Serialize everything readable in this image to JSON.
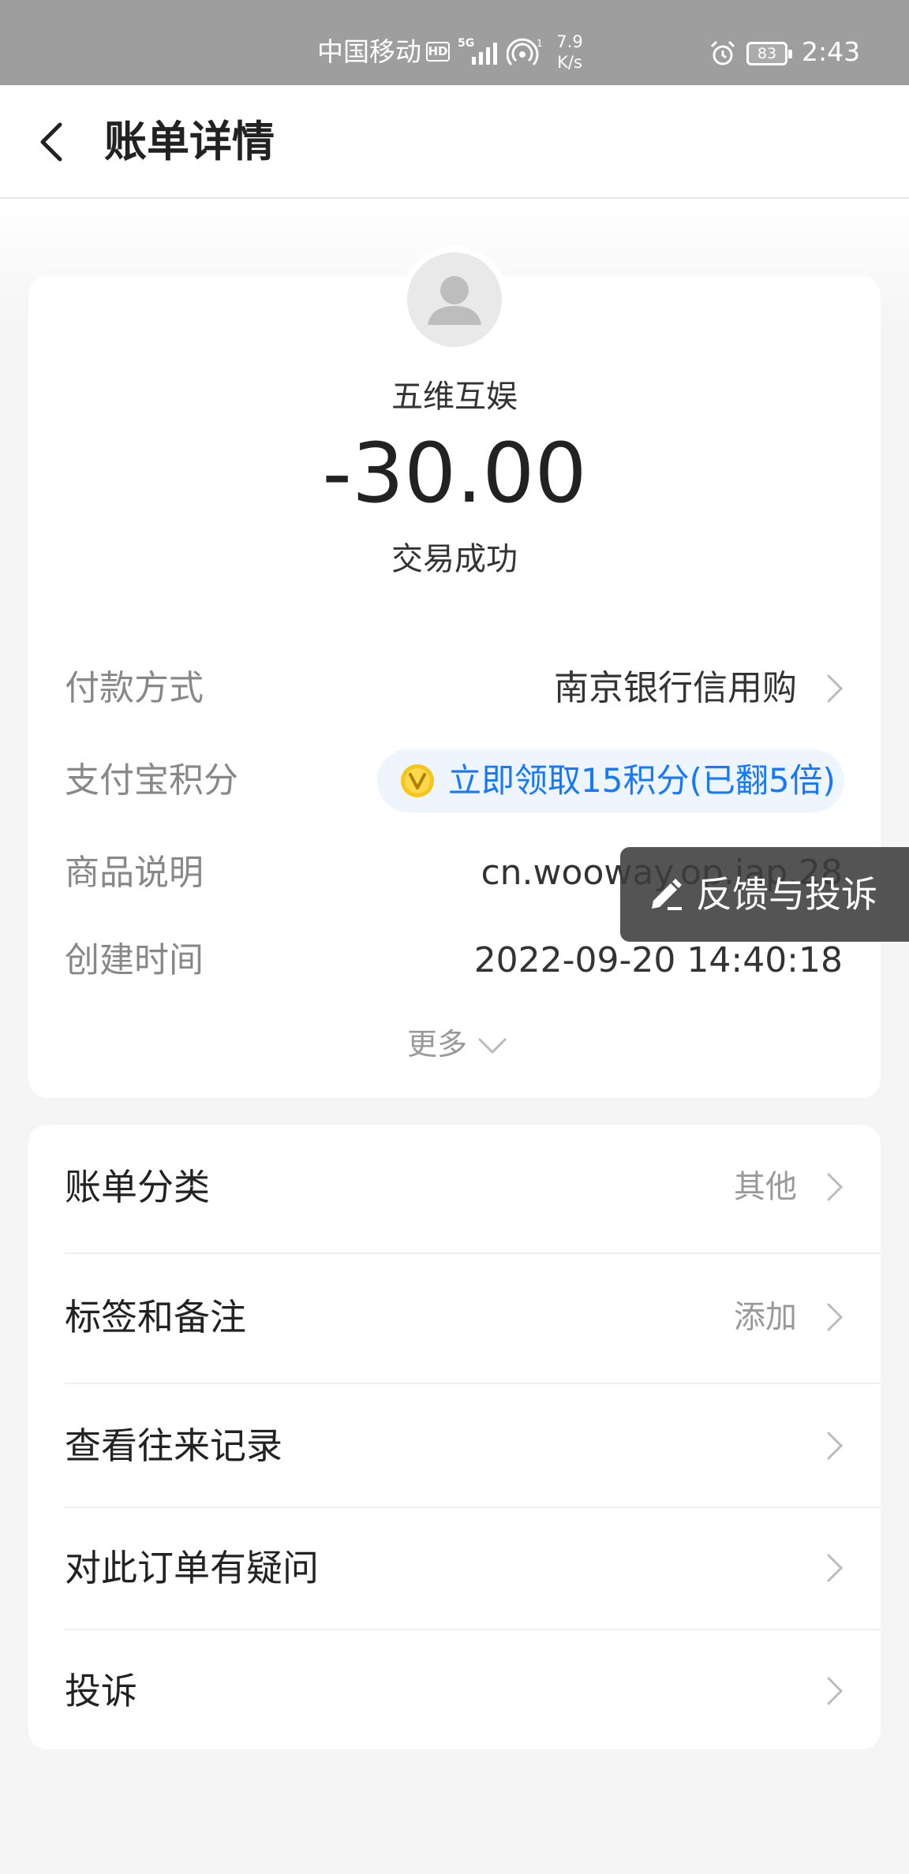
{
  "status_bar": {
    "carrier": "中国移动",
    "hd": "HD",
    "network": "5G",
    "hotspot_count": "1",
    "speed_value": "7.9",
    "speed_unit": "K/s",
    "battery": "83",
    "time": "2:43"
  },
  "nav": {
    "title": "账单详情"
  },
  "summary": {
    "merchant": "五维互娱",
    "amount": "-30.00",
    "status": "交易成功"
  },
  "details": {
    "payment_method_label": "付款方式",
    "payment_method_value": "南京银行信用购",
    "points_label": "支付宝积分",
    "points_value": "立即领取15积分(已翻5倍)",
    "product_label": "商品说明",
    "product_value": "cn.wooway.op.jap.28",
    "created_label": "创建时间",
    "created_value": "2022-09-20 14:40:18",
    "more": "更多"
  },
  "feedback": {
    "label": "反馈与投诉"
  },
  "actions": [
    {
      "label": "账单分类",
      "value": "其他"
    },
    {
      "label": "标签和备注",
      "value": "添加"
    },
    {
      "label": "查看往来记录",
      "value": ""
    },
    {
      "label": "对此订单有疑问",
      "value": ""
    },
    {
      "label": "投诉",
      "value": ""
    }
  ],
  "colors": {
    "accent": "#1677ff",
    "status_bar": "#9e9e9e",
    "background": "#f5f5f5"
  }
}
